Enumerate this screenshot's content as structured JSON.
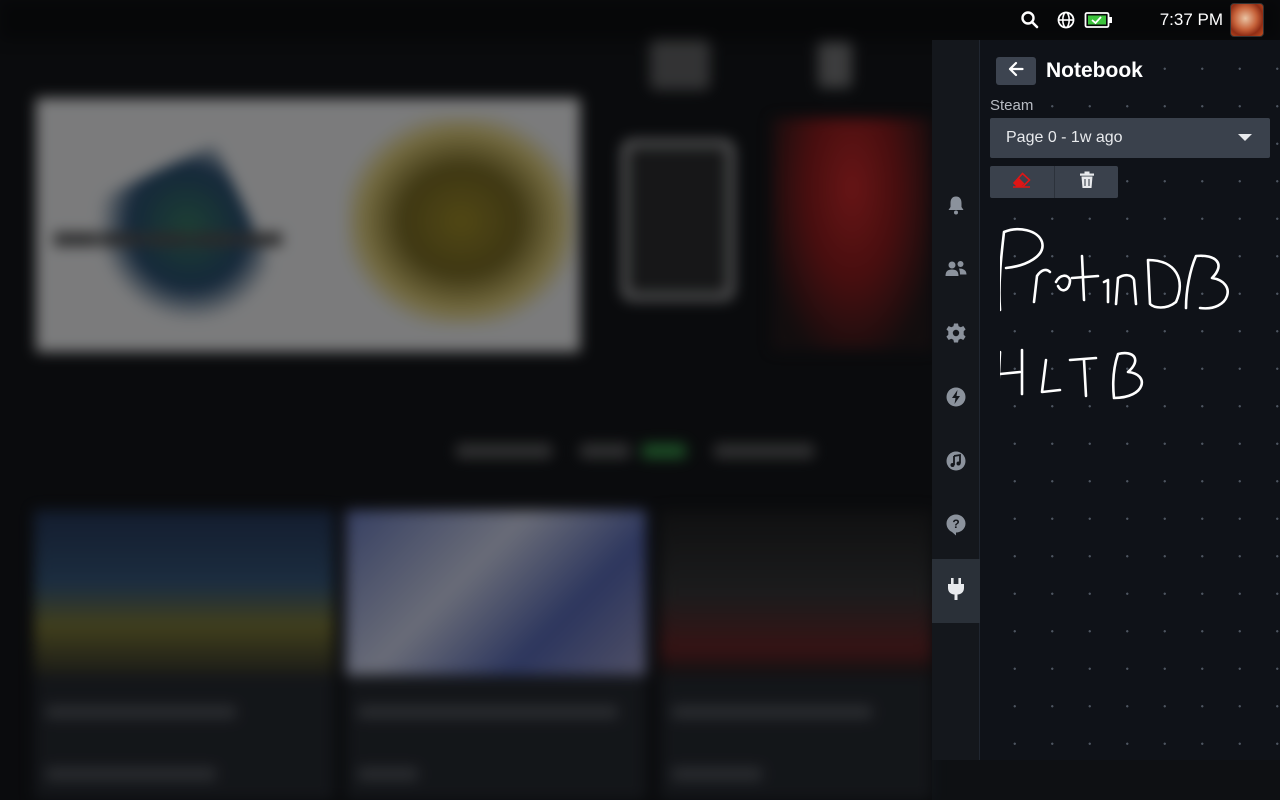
{
  "statusbar": {
    "icons": [
      "search-icon",
      "globe-icon",
      "battery-charging-icon"
    ],
    "time": "7:37 PM",
    "battery_color": "#3cc23c"
  },
  "quick_access": {
    "rail": [
      "bell-icon",
      "friends-icon",
      "gear-icon",
      "lightning-icon",
      "music-icon",
      "help-icon",
      "plug-icon"
    ],
    "active_rail_item": "plug-icon"
  },
  "notebook": {
    "title": "Notebook",
    "section_label": "Steam",
    "page_select": {
      "selected": "Page 0 - 1w ago"
    },
    "tools": [
      "eraser-icon",
      "trash-icon"
    ],
    "eraser_color": "#e01515",
    "handwriting": [
      "ProtonDB",
      "HLTB"
    ]
  }
}
